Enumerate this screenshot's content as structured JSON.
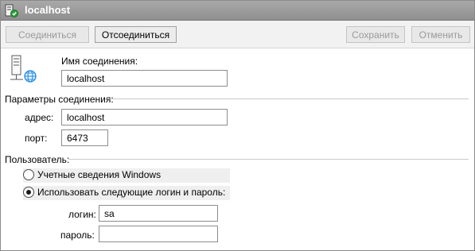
{
  "window": {
    "title": "localhost"
  },
  "toolbar": {
    "connect_label": "Соединиться",
    "disconnect_label": "Отсоединиться",
    "save_label": "Сохранить",
    "cancel_label": "Отменить"
  },
  "connection": {
    "name_label": "Имя соединения:",
    "name_value": "localhost"
  },
  "params": {
    "section_label": "Параметры соединения:",
    "address_label": "адрес:",
    "address_value": "localhost",
    "port_label": "порт:",
    "port_value": "6473"
  },
  "user": {
    "section_label": "Пользователь:",
    "option_windows": "Учетные сведения Windows",
    "option_login": "Использовать следующие логин и пароль:",
    "selected_option": "login",
    "login_label": "логин:",
    "login_value": "sa",
    "password_label": "пароль:",
    "password_value": ""
  },
  "icons": {
    "title": "server-connection-icon",
    "connection": "server-globe-icon"
  },
  "colors": {
    "titlebar": "#9d9d9d",
    "title_text": "#ffffff",
    "toolbar": "#f2f2f2",
    "globe": "#1e88e5",
    "status_green": "#2e9e3a"
  }
}
